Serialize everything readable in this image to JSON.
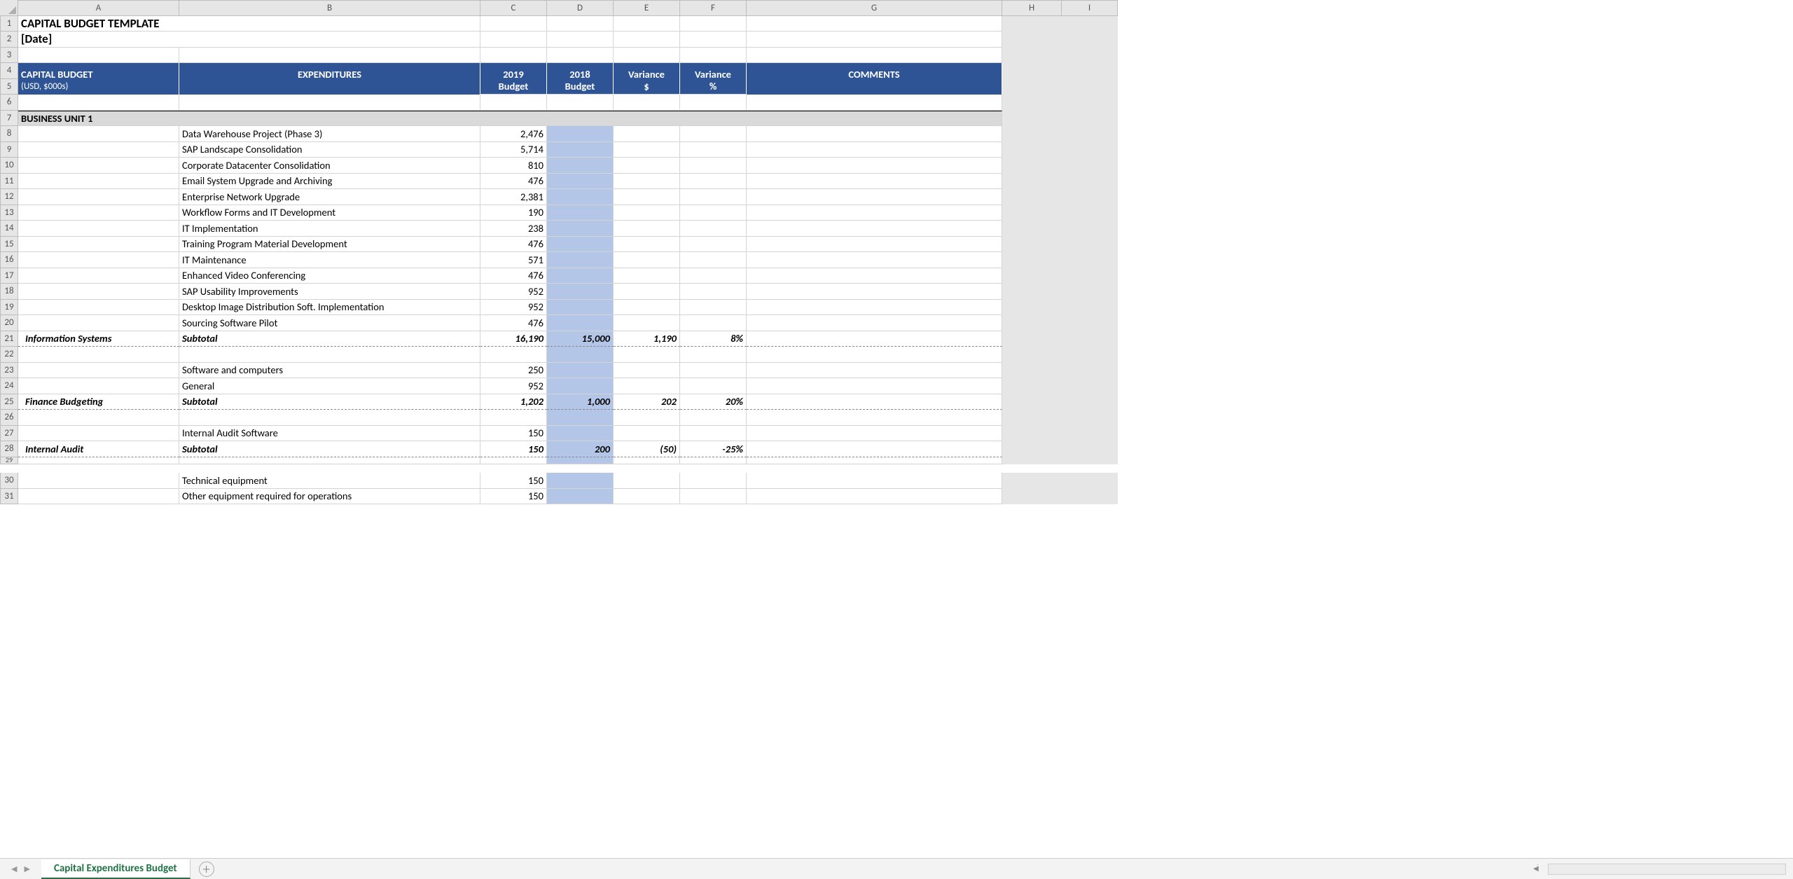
{
  "columns": [
    "A",
    "B",
    "C",
    "D",
    "E",
    "F",
    "G",
    "H",
    "I"
  ],
  "title": "CAPITAL BUDGET TEMPLATE",
  "date_placeholder": "[Date]",
  "header": {
    "capital_budget": "CAPITAL BUDGET",
    "currency_note": "(USD, $000s)",
    "expenditures": "EXPENDITURES",
    "year_current": "2019",
    "year_prior": "2018",
    "variance_dollar_top": "Variance",
    "variance_pct_top": "Variance",
    "budget_current": "Budget",
    "budget_prior": "Budget",
    "variance_dollar": "$",
    "variance_pct": "%",
    "comments": "COMMENTS"
  },
  "unit1_label": "BUSINESS UNIT 1",
  "rows": [
    {
      "desc": "Data Warehouse Project (Phase 3)",
      "v2019": "2,476"
    },
    {
      "desc": "SAP Landscape Consolidation",
      "v2019": "5,714"
    },
    {
      "desc": "Corporate Datacenter Consolidation",
      "v2019": "810"
    },
    {
      "desc": "Email System Upgrade and Archiving",
      "v2019": "476"
    },
    {
      "desc": "Enterprise Network Upgrade",
      "v2019": "2,381"
    },
    {
      "desc": "Workflow Forms and IT Development",
      "v2019": "190"
    },
    {
      "desc": "IT Implementation",
      "v2019": "238"
    },
    {
      "desc": "Training Program Material Development",
      "v2019": "476"
    },
    {
      "desc": "IT Maintenance",
      "v2019": "571"
    },
    {
      "desc": "Enhanced Video Conferencing",
      "v2019": "476"
    },
    {
      "desc": "SAP Usability Improvements",
      "v2019": "952"
    },
    {
      "desc": "Desktop Image Distribution Soft. Implementation",
      "v2019": "952"
    },
    {
      "desc": "Sourcing Software Pilot",
      "v2019": "476"
    }
  ],
  "subtotal_info_systems": {
    "group": "Information Systems",
    "label": "Subtotal",
    "v2019": "16,190",
    "v2018": "15,000",
    "var_d": "1,190",
    "var_p": "8%"
  },
  "finance_rows": [
    {
      "desc": "Software and computers",
      "v2019": "250"
    },
    {
      "desc": "General",
      "v2019": "952"
    }
  ],
  "subtotal_finance": {
    "group": "Finance Budgeting",
    "label": "Subtotal",
    "v2019": "1,202",
    "v2018": "1,000",
    "var_d": "202",
    "var_p": "20%"
  },
  "audit_rows": [
    {
      "desc": "Internal Audit Software",
      "v2019": "150"
    }
  ],
  "subtotal_audit": {
    "group": "Internal Audit",
    "label": "Subtotal",
    "v2019": "150",
    "v2018": "200",
    "var_d": "(50)",
    "var_p": "-25%"
  },
  "extra_rows": [
    {
      "desc": "Technical equipment",
      "v2019": "150"
    },
    {
      "desc": "Other equipment required for operations",
      "v2019": "150"
    }
  ],
  "sheet_tab": "Capital Expenditures Budget"
}
